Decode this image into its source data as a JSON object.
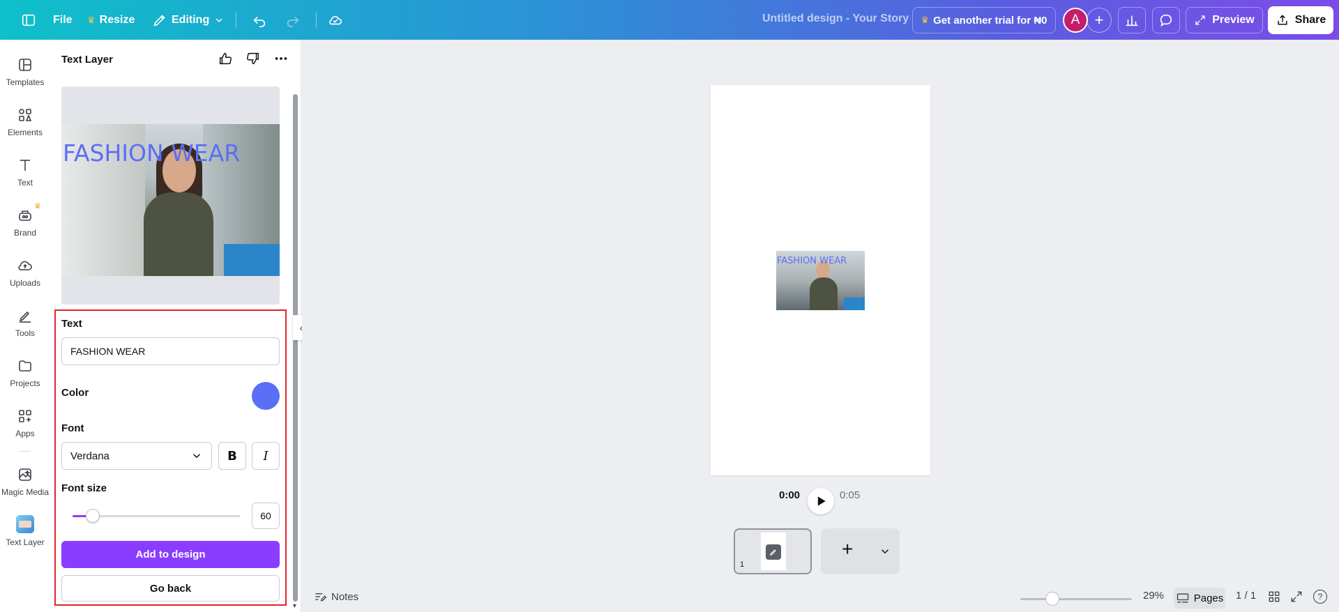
{
  "topbar": {
    "file_label": "File",
    "resize_label": "Resize",
    "editing_label": "Editing",
    "document_title": "Untitled design - Your Story",
    "trial_label": "Get another trial for ₦0",
    "avatar_initial": "A",
    "preview_label": "Preview",
    "share_label": "Share"
  },
  "rail": {
    "items": [
      {
        "label": "Templates",
        "icon": "templates-icon"
      },
      {
        "label": "Elements",
        "icon": "elements-icon"
      },
      {
        "label": "Text",
        "icon": "text-icon"
      },
      {
        "label": "Brand",
        "icon": "brand-icon"
      },
      {
        "label": "Uploads",
        "icon": "uploads-icon"
      },
      {
        "label": "Tools",
        "icon": "tools-icon"
      },
      {
        "label": "Projects",
        "icon": "projects-icon"
      },
      {
        "label": "Apps",
        "icon": "apps-icon"
      },
      {
        "label": "Magic Media",
        "icon": "magic-media-icon"
      },
      {
        "label": "Text Layer",
        "icon": "text-layer-app-icon"
      }
    ]
  },
  "panel": {
    "title": "Text Layer",
    "preview_text": "FASHION WEAR",
    "text_label": "Text",
    "text_value": "FASHION WEAR",
    "color_label": "Color",
    "color_value": "#5a6ff5",
    "font_label": "Font",
    "font_value": "Verdana",
    "bold_label": "B",
    "italic_label": "I",
    "font_size_label": "Font size",
    "font_size_value": "60",
    "font_size_fraction": 0.12,
    "add_button": "Add to design",
    "back_button": "Go back"
  },
  "canvas": {
    "mini_text": "FASHION WEAR",
    "time_current": "0:00",
    "time_total": "0:05",
    "page_number": "1",
    "notes_label": "Notes",
    "zoom_value": "29%",
    "zoom_fraction": 0.29,
    "pages_label": "Pages",
    "page_count": "1 / 1",
    "help_label": "?"
  },
  "colors": {
    "accent_purple": "#8b3dff",
    "text_color_swatch": "#5a6ff5",
    "highlight_red": "#e0242a",
    "avatar_bg": "#c41d6b"
  }
}
